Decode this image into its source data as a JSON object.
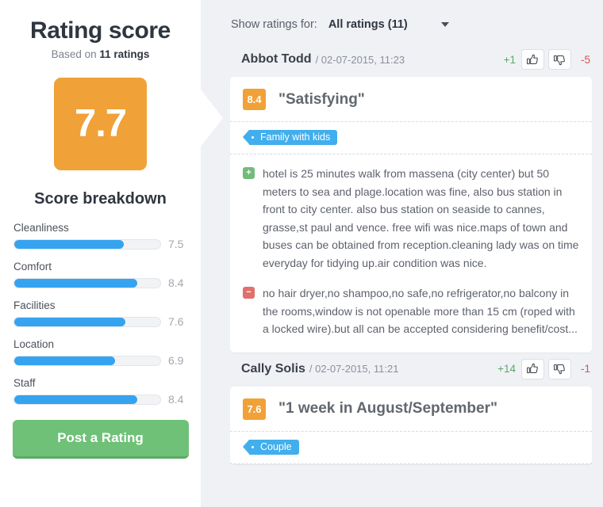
{
  "colors": {
    "orange": "#f0a137",
    "blue": "#36a3f0",
    "green": "#6ec177",
    "tag_blue": "#41aeed",
    "pro_green": "#72bb7b",
    "con_red": "#e0706c",
    "page_bg": "#eff1f5"
  },
  "sidebar": {
    "title": "Rating score",
    "subtitle_prefix": "Based on ",
    "subtitle_strong": "11 ratings",
    "score": "7.7",
    "breakdown_title": "Score breakdown",
    "breakdown": [
      {
        "label": "Cleanliness",
        "value": "7.5",
        "percent": 75
      },
      {
        "label": "Comfort",
        "value": "8.4",
        "percent": 84
      },
      {
        "label": "Facilities",
        "value": "7.6",
        "percent": 76
      },
      {
        "label": "Location",
        "value": "6.9",
        "percent": 69
      },
      {
        "label": "Staff",
        "value": "8.4",
        "percent": 84
      }
    ],
    "post_button": "Post a Rating"
  },
  "filter": {
    "label": "Show ratings for:",
    "selected": "All ratings (11)",
    "caret": "chevron-down-icon"
  },
  "reviews": [
    {
      "author": "Abbot Todd",
      "meta": "/ 02-07-2015, 11:23",
      "upvotes": "+1",
      "downvotes": "-5",
      "score": "8.4",
      "title": "\"Satisfying\"",
      "tags": [
        "Family with kids"
      ],
      "pros": "hotel is 25 minutes walk from massena (city center) but 50 meters to sea and plage.location was fine, also bus station in front to city center. also bus station on seaside to cannes, grasse,st paul and vence. free wifi was nice.maps of town and buses can be obtained from reception.cleaning lady was on time everyday for tidying up.air condition was nice.",
      "cons": "no hair dryer,no shampoo,no safe,no refrigerator,no balcony in the rooms,window is not openable more than 15 cm (roped with a locked wire).but all can be accepted considering benefit/cost..."
    },
    {
      "author": "Cally Solis",
      "meta": "/ 02-07-2015, 11:21",
      "upvotes": "+14",
      "downvotes": "-1",
      "score": "7.6",
      "title": "\"1 week in August/September\"",
      "tags": [
        "Couple"
      ],
      "pros": "",
      "cons": ""
    }
  ]
}
